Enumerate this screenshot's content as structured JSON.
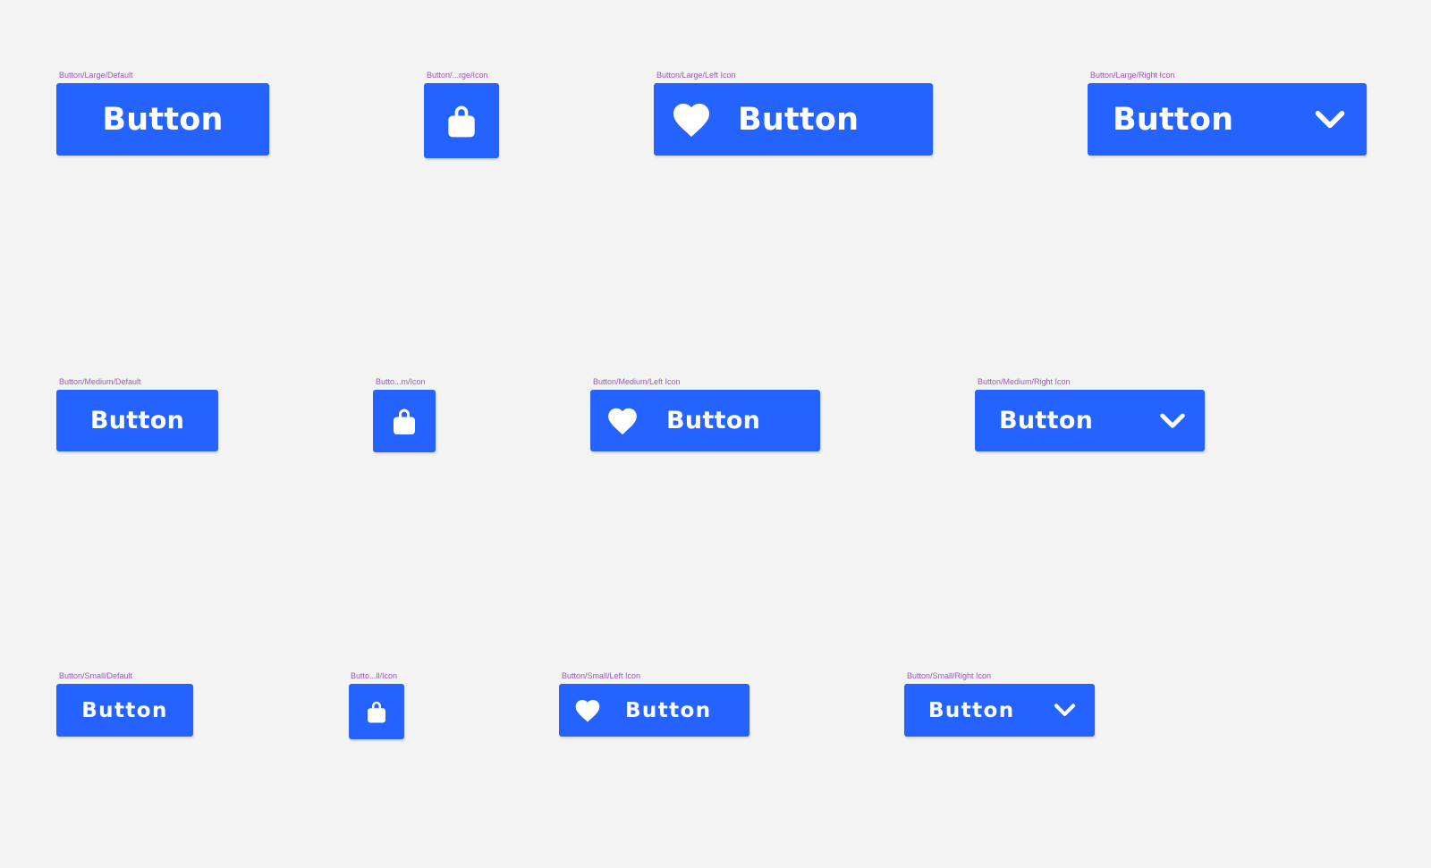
{
  "colors": {
    "background": "#f3f3f4",
    "button": "#2463ff",
    "button_text": "#ffffff",
    "frame_label": "#9b59b6"
  },
  "icons": {
    "icon_only": "shopping-bag-icon",
    "left": "heart-icon",
    "right": "chevron-down-icon"
  },
  "large": {
    "default": {
      "frame_label": "Button/Large/Default",
      "label": "Button"
    },
    "icon": {
      "frame_label": "Button/...rge/Icon"
    },
    "left_icon": {
      "frame_label": "Button/Large/Left Icon",
      "label": "Button"
    },
    "right_icon": {
      "frame_label": "Button/Large/Right Icon",
      "label": "Button"
    }
  },
  "medium": {
    "default": {
      "frame_label": "Button/Medium/Default",
      "label": "Button"
    },
    "icon": {
      "frame_label": "Butto...m/Icon"
    },
    "left_icon": {
      "frame_label": "Button/Medium/Left Icon",
      "label": "Button"
    },
    "right_icon": {
      "frame_label": "Button/Medium/Right Icon",
      "label": "Button"
    }
  },
  "small": {
    "default": {
      "frame_label": "Button/Small/Default",
      "label": "Button"
    },
    "icon": {
      "frame_label": "Butto...ll/Icon"
    },
    "left_icon": {
      "frame_label": "Button/Small/Left Icon",
      "label": "Button"
    },
    "right_icon": {
      "frame_label": "Button/Small/Right Icon",
      "label": "Button"
    }
  }
}
